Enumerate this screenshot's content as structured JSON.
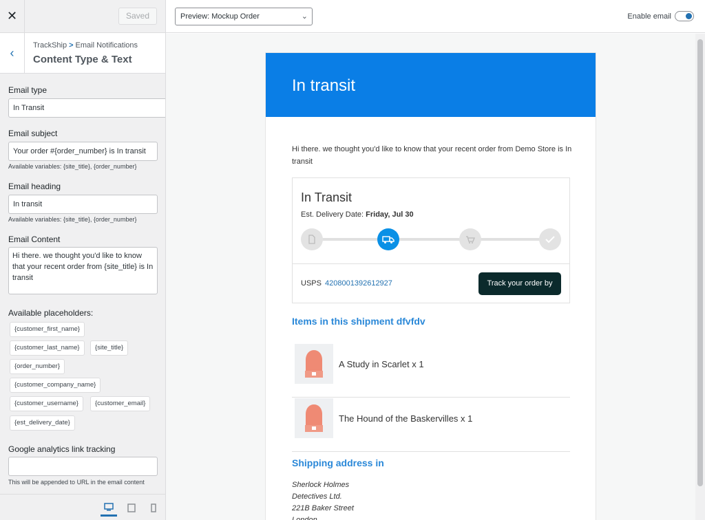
{
  "sidebar": {
    "close_icon": "close-icon",
    "saved_label": "Saved",
    "breadcrumb": {
      "root": "TrackShip",
      "separator": ">",
      "current": "Email Notifications"
    },
    "section_title": "Content Type & Text",
    "email_type": {
      "label": "Email type",
      "value": "In Transit"
    },
    "email_subject": {
      "label": "Email subject",
      "value": "Your order #{order_number} is In transit",
      "hint": "Available variables: {site_title}, {order_number}"
    },
    "email_heading": {
      "label": "Email heading",
      "value": "In transit",
      "hint": "Available variables: {site_title}, {order_number}"
    },
    "email_content": {
      "label": "Email Content",
      "value": "Hi there. we thought you'd like to know that your recent order from {site_title} is In transit"
    },
    "placeholders": {
      "label": "Available placeholders:",
      "items": [
        "{customer_first_name}",
        "{customer_last_name}",
        "{site_title}",
        "{order_number}",
        "{customer_company_name}",
        "{customer_username}",
        "{customer_email}",
        "{est_delivery_date}"
      ]
    },
    "ga_tracking": {
      "label": "Google analytics link tracking",
      "value": "",
      "hint": "This will be appended to URL in the email content"
    },
    "devices": [
      "desktop",
      "tablet",
      "mobile"
    ]
  },
  "topbar": {
    "preview_select": "Preview: Mockup Order",
    "enable_label": "Enable email",
    "enabled": true
  },
  "email": {
    "heading": "In transit",
    "intro": "Hi there. we thought you'd like to know that your recent order from Demo Store is In transit",
    "tracking": {
      "status": "In Transit",
      "est_label": "Est. Delivery Date:",
      "est_value": "Friday, Jul 30",
      "steps": [
        "label-created",
        "in-transit",
        "out-for-delivery",
        "delivered"
      ],
      "current_step": 1,
      "carrier": "USPS",
      "tracking_number": "4208001392612927",
      "button": "Track your order by"
    },
    "items_title": "Items in this shipment dfvfdv",
    "items": [
      {
        "name": "A Study in Scarlet x 1"
      },
      {
        "name": "The Hound of the Baskervilles x 1"
      }
    ],
    "shipping_title": "Shipping address in",
    "address": [
      "Sherlock Holmes",
      "Detectives Ltd.",
      "221B Baker Street",
      "London"
    ],
    "colors": {
      "header": "#0a7ee6",
      "link": "#2a88d8",
      "button": "#0b2a2c",
      "active_step": "#0a90e6"
    }
  }
}
